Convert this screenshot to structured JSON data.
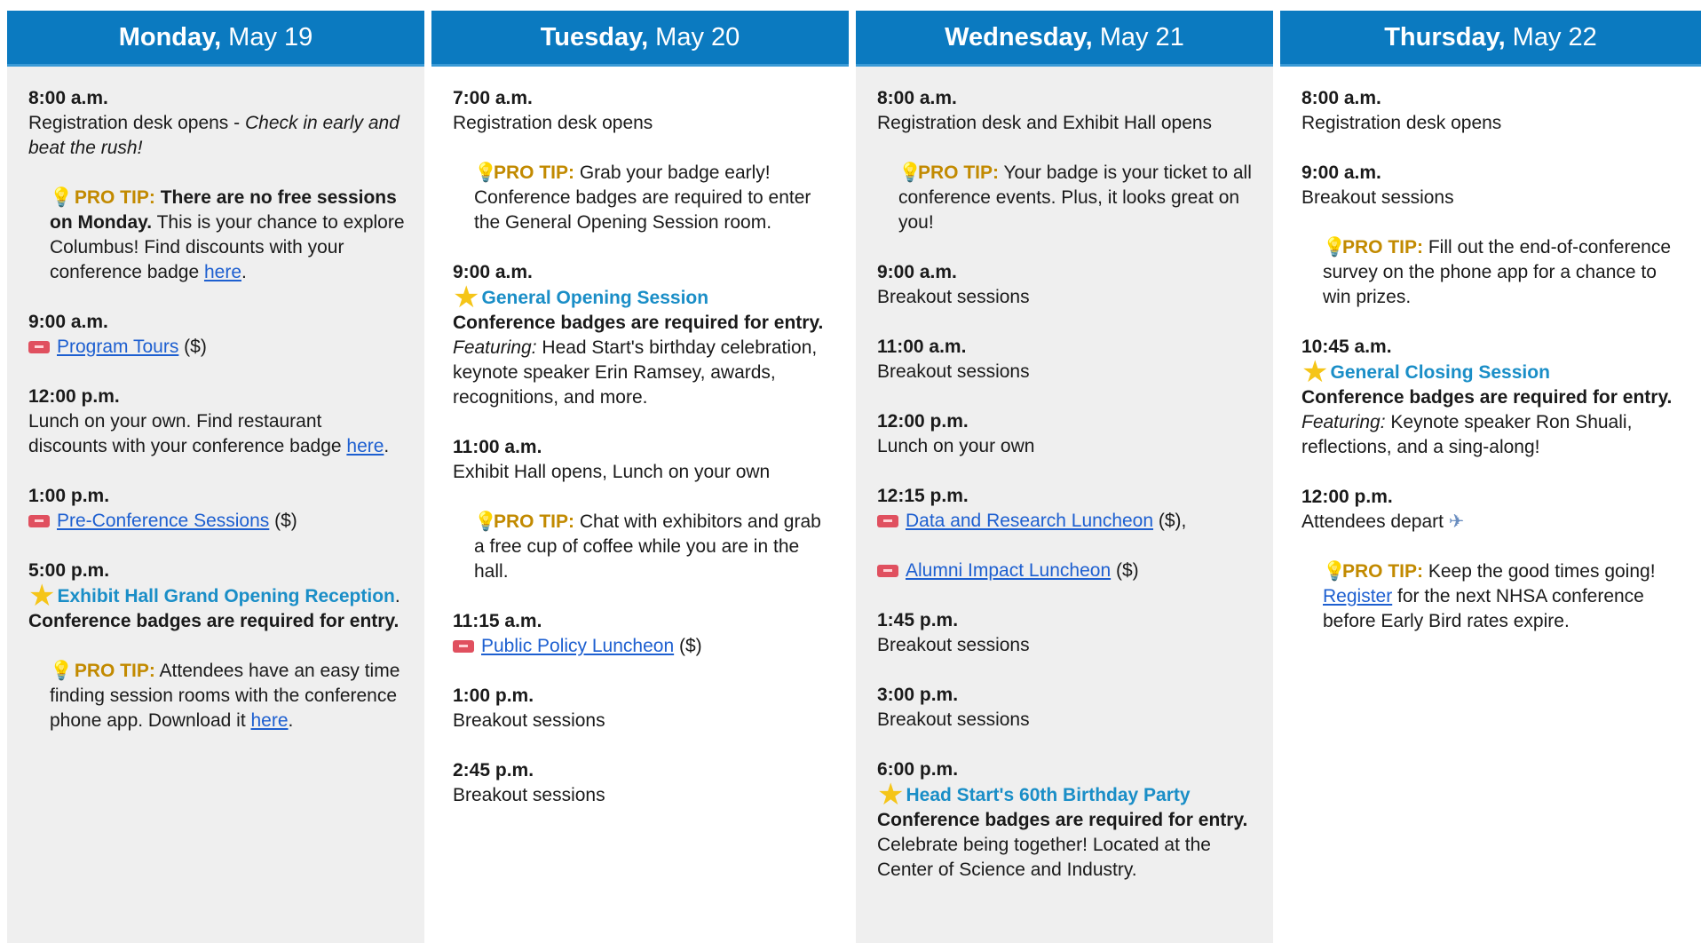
{
  "days": [
    {
      "name": "Monday,",
      "date": "May 19",
      "events": [
        {
          "time": "8:00 a.m.",
          "text": "Registration desk opens - ",
          "italic": "Check in early and beat the rush!"
        },
        {
          "tip": true,
          "label": "PRO TIP:",
          "bold": " There are no free sessions on Monday.",
          "text": " This is your chance to explore Columbus! Find discounts with your conference badge ",
          "link": "here",
          "after": "."
        },
        {
          "time": "9:00 a.m.",
          "ticket": true,
          "link": "Program Tours",
          "after": " ($)"
        },
        {
          "time": "12:00 p.m.",
          "text": "Lunch on your own. Find restaurant discounts with your conference badge ",
          "link": "here",
          "after": "."
        },
        {
          "time": "1:00 p.m.",
          "ticket": true,
          "link": "Pre-Conference Sessions",
          "after": " ($)"
        },
        {
          "time": "5:00 p.m.",
          "star": true,
          "special": "Exhibit Hall Grand Opening Reception",
          "after": ".",
          "bold_line": "Conference badges are required for entry."
        },
        {
          "tip": true,
          "label": "PRO TIP:",
          "text": " Attendees have an easy time finding session rooms with the conference phone app. Download it ",
          "link": "here",
          "after": "."
        }
      ]
    },
    {
      "name": "Tuesday,",
      "date": "May 20",
      "events": [
        {
          "time": "7:00 a.m.",
          "text": "Registration desk opens"
        },
        {
          "tip": true,
          "label": "PRO TIP:",
          "text": " Grab your badge early! Conference badges are required to enter the General Opening Session room."
        },
        {
          "time": "9:00 a.m.",
          "star": true,
          "special": "General Opening Session",
          "bold_line": "Conference badges are required for entry.",
          "featuring": "Featuring:",
          "text": " Head Start's birthday celebration, keynote speaker Erin Ramsey, awards, recognitions, and more."
        },
        {
          "time": "11:00 a.m.",
          "text": "Exhibit Hall opens, Lunch on your own"
        },
        {
          "tip": true,
          "label": "PRO TIP:",
          "text": " Chat with exhibitors and grab a free cup of coffee while you are in the hall."
        },
        {
          "time": "11:15 a.m.",
          "ticket": true,
          "link": "Public Policy Luncheon",
          "after": " ($)"
        },
        {
          "time": "1:00 p.m.",
          "text": "Breakout sessions"
        },
        {
          "time": "2:45 p.m.",
          "text": "Breakout sessions"
        }
      ]
    },
    {
      "name": "Wednesday,",
      "date": "May 21",
      "events": [
        {
          "time": "8:00 a.m.",
          "text": "Registration desk and Exhibit Hall opens"
        },
        {
          "tip": true,
          "label": "PRO TIP:",
          "text": " Your badge is your ticket to all conference events. Plus, it looks great on you!"
        },
        {
          "time": "9:00 a.m.",
          "text": "Breakout sessions"
        },
        {
          "time": "11:00 a.m.",
          "text": "Breakout sessions"
        },
        {
          "time": "12:00 p.m.",
          "text": "Lunch on your own"
        },
        {
          "time": "12:15 p.m.",
          "ticket": true,
          "link": "Data and Research Luncheon",
          "after": " ($),"
        },
        {
          "ticket": true,
          "link": "Alumni Impact Luncheon",
          "after": " ($)"
        },
        {
          "time": "1:45 p.m.",
          "text": "Breakout sessions"
        },
        {
          "time": "3:00 p.m.",
          "text": "Breakout sessions"
        },
        {
          "time": "6:00 p.m.",
          "star": true,
          "special": "Head Start's 60th Birthday Party",
          "bold_line": "Conference badges are required for entry.",
          "text": "Celebrate being together! Located at the Center of Science and Industry."
        }
      ]
    },
    {
      "name": "Thursday,",
      "date": "May 22",
      "events": [
        {
          "time": "8:00 a.m.",
          "text": "Registration desk opens"
        },
        {
          "time": "9:00 a.m.",
          "text": "Breakout sessions"
        },
        {
          "tip": true,
          "label": "PRO TIP:",
          "text": " Fill out the end-of-conference survey on the phone app for a chance to win prizes."
        },
        {
          "time": "10:45 a.m.",
          "star": true,
          "special": "General Closing Session",
          "bold_line": "Conference badges are required for entry.",
          "featuring": "Featuring:",
          "text": " Keynote speaker Ron Shuali, reflections, and a sing-along!"
        },
        {
          "time": "12:00 p.m.",
          "text": "Attendees depart ",
          "plane": "✈️"
        },
        {
          "tip": true,
          "label": "PRO TIP:",
          "text": " Keep the good times going! ",
          "link": "Register",
          "after": " for the next NHSA conference before Early Bird rates expire."
        }
      ]
    }
  ],
  "icons": {
    "tip": "lightbulb-icon",
    "ticket": "ticket-icon",
    "star": "star-icon",
    "plane": "airplane-icon"
  },
  "colors": {
    "header": "#0b7ac0",
    "tip_label": "#c28a00",
    "special": "#1a8ec7",
    "link": "#1d5fd0",
    "shade": "#efefef"
  }
}
